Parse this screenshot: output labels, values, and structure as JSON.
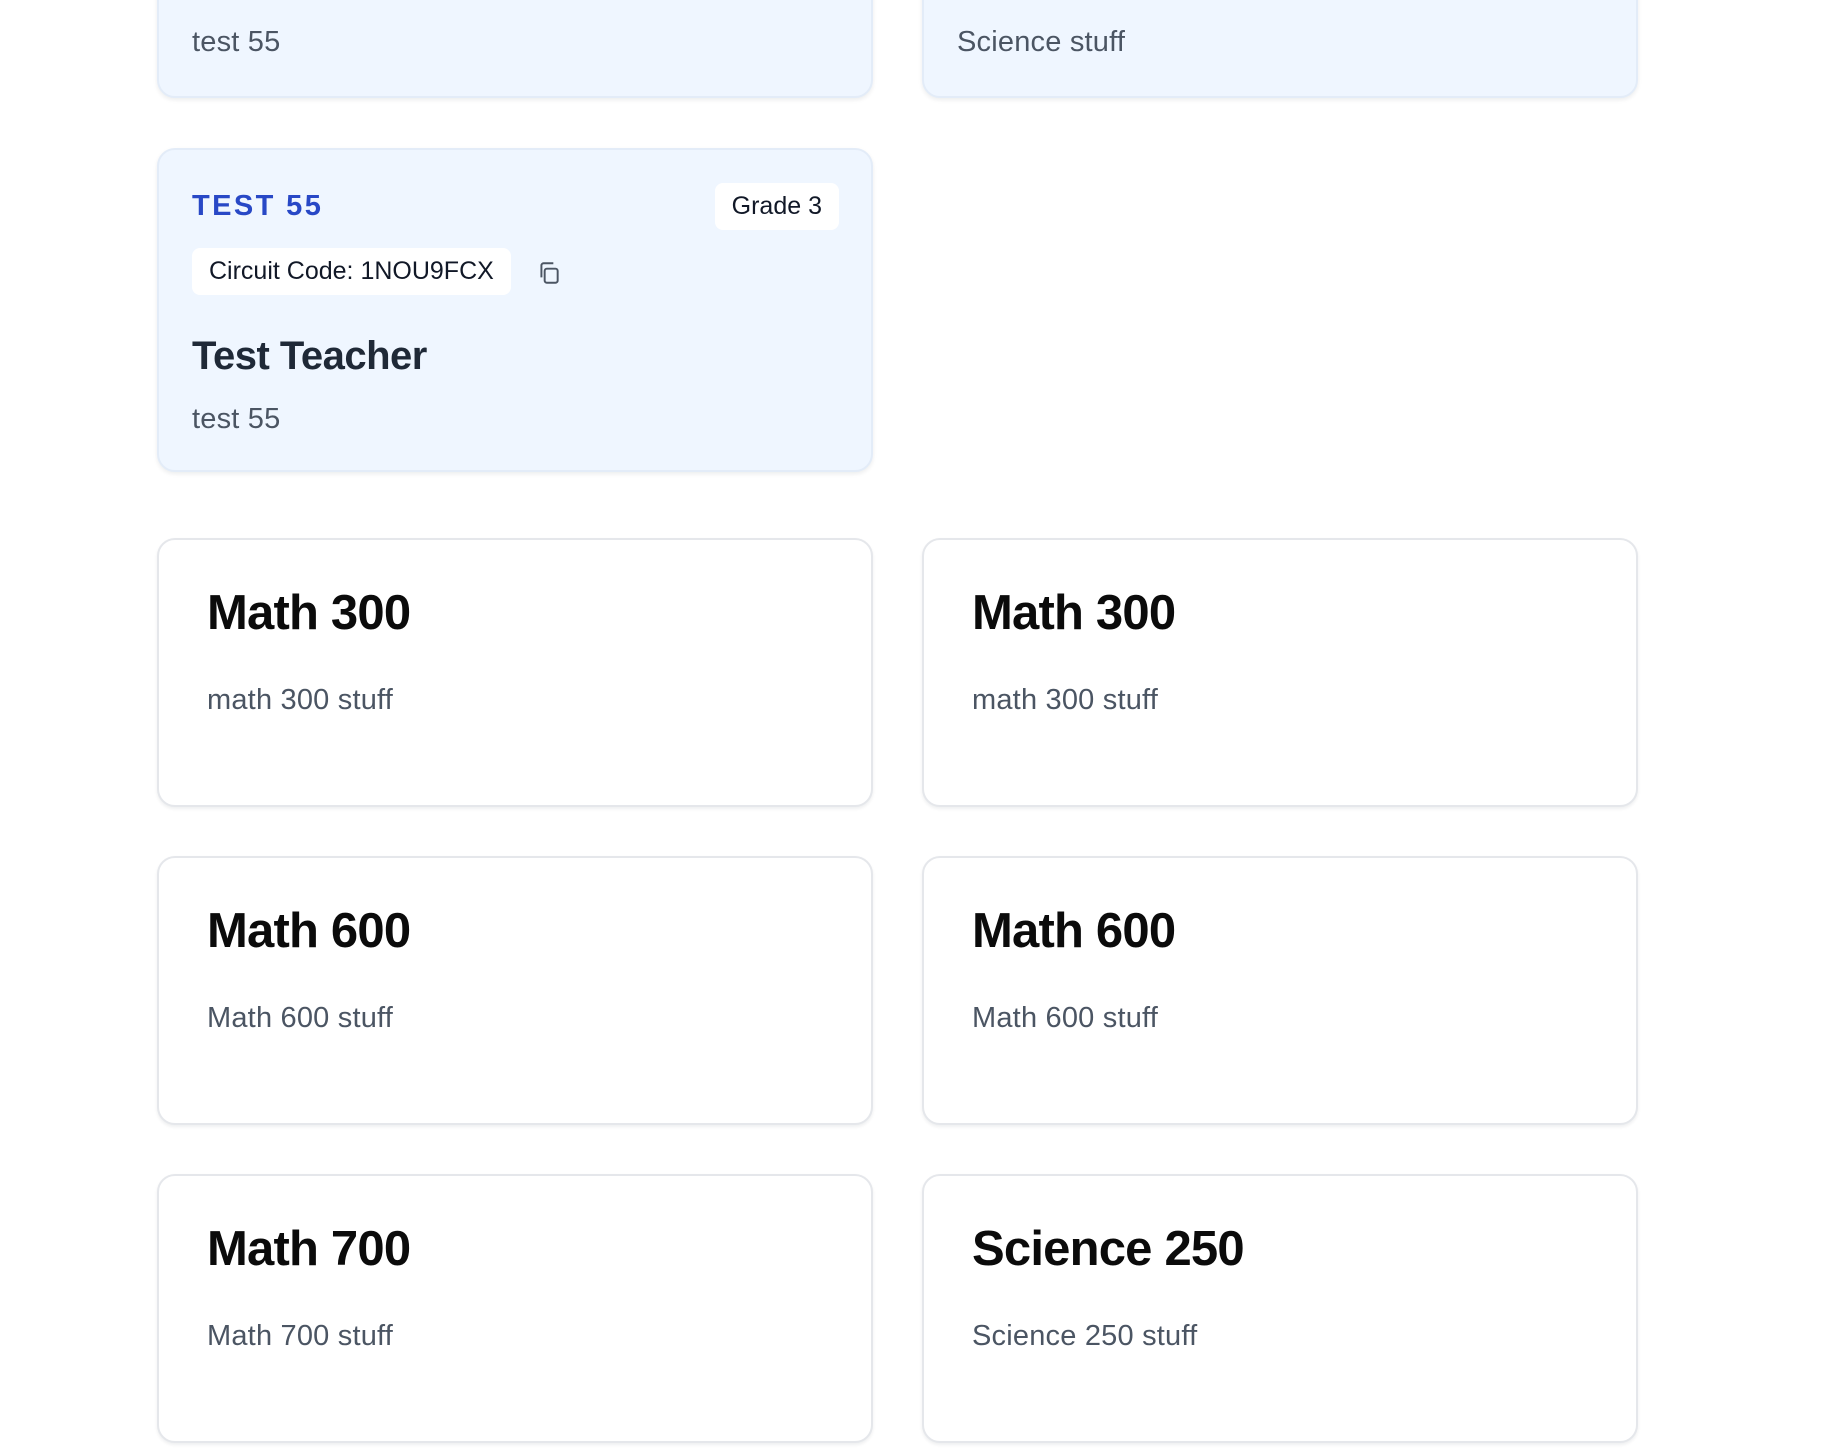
{
  "partial_cards": [
    {
      "description": "test 55"
    },
    {
      "description": "Science stuff"
    }
  ],
  "class_card": {
    "name": "TEST 55",
    "grade": "Grade 3",
    "circuit_code": "Circuit Code: 1NOU9FCX",
    "teacher": "Test Teacher",
    "description": "test 55",
    "copy_icon": "copy-icon"
  },
  "courses": [
    {
      "title": "Math 300",
      "description": "math 300 stuff"
    },
    {
      "title": "Math 300",
      "description": "math 300 stuff"
    },
    {
      "title": "Math 600",
      "description": "Math 600 stuff"
    },
    {
      "title": "Math 600",
      "description": "Math 600 stuff"
    },
    {
      "title": "Math 700",
      "description": "Math 700 stuff"
    },
    {
      "title": "Science 250",
      "description": "Science 250 stuff"
    }
  ],
  "colors": {
    "class_card_bg": "#eff6ff",
    "class_name": "#2848c6",
    "course_card_bg": "#ffffff"
  }
}
